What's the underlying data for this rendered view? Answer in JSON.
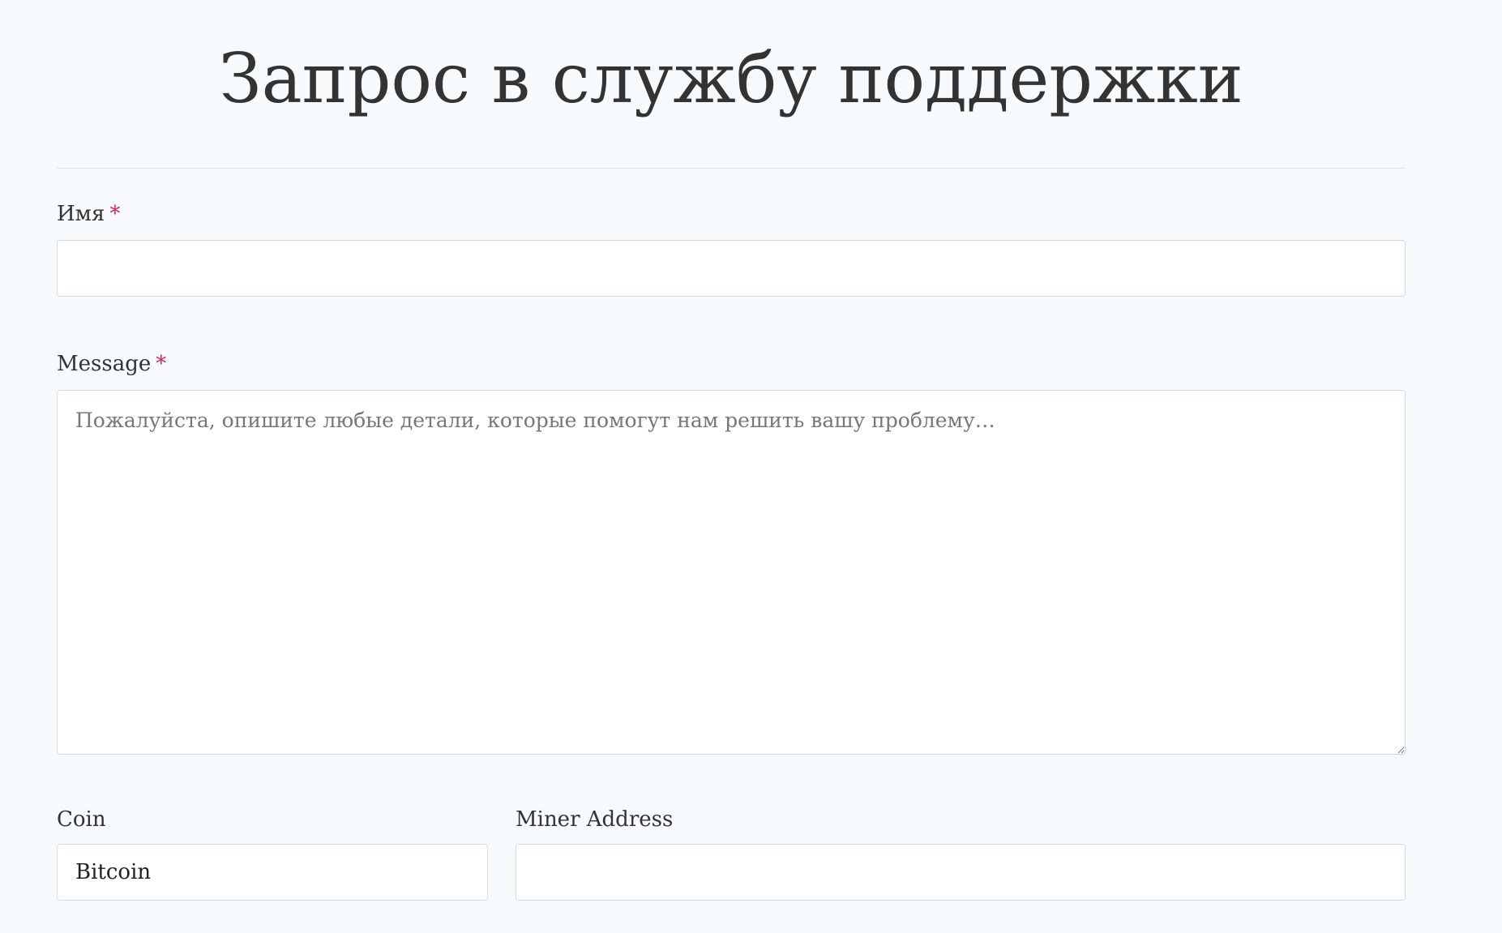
{
  "form": {
    "title": "Запрос в службу поддержки",
    "name_field": {
      "label": "Имя",
      "required_mark": "*",
      "value": ""
    },
    "message_field": {
      "label": "Message",
      "required_mark": "*",
      "placeholder": "Пожалуйста, опишите любые детали, которые помогут нам решить вашу проблему…",
      "value": ""
    },
    "coin_field": {
      "label": "Coin",
      "value": "Bitcoin"
    },
    "miner_address_field": {
      "label": "Miner Address",
      "value": ""
    }
  },
  "colors": {
    "background": "#f6fafc",
    "text": "#333333",
    "required": "#e0245e",
    "border": "#d5dadf"
  }
}
